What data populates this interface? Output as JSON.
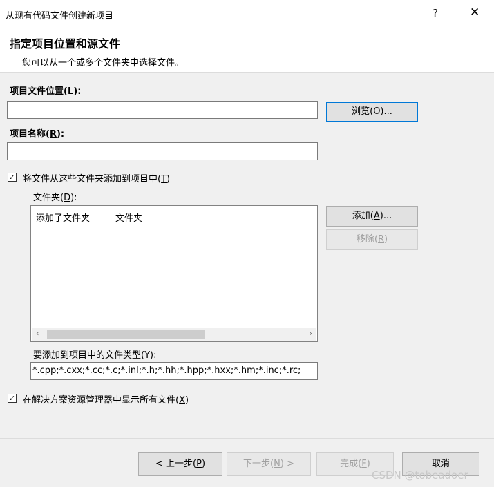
{
  "window": {
    "title": "从现有代码文件创建新项目",
    "help": "?",
    "close": "✕"
  },
  "header": {
    "title": "指定项目位置和源文件",
    "subtitle": "您可以从一个或多个文件夹中选择文件。"
  },
  "location": {
    "label_pre": "项目文件位置(",
    "label_key": "L",
    "label_post": "):",
    "value": "",
    "browse_pre": "浏览(",
    "browse_key": "O",
    "browse_post": ")..."
  },
  "name": {
    "label_pre": "项目名称(",
    "label_key": "R",
    "label_post": "):",
    "value": ""
  },
  "add_folders": {
    "checked": true,
    "label_pre": "将文件从这些文件夹添加到项目中(",
    "label_key": "T",
    "label_post": ")"
  },
  "folders": {
    "label_pre": "文件夹(",
    "label_key": "D",
    "label_post": "):",
    "columns": [
      "添加子文件夹",
      "文件夹"
    ],
    "add_pre": "添加(",
    "add_key": "A",
    "add_post": ")...",
    "remove_pre": "移除(",
    "remove_key": "R",
    "remove_post": ")"
  },
  "filetypes": {
    "label_pre": "要添加到项目中的文件类型(",
    "label_key": "Y",
    "label_post": "):",
    "value": "*.cpp;*.cxx;*.cc;*.c;*.inl;*.h;*.hh;*.hpp;*.hxx;*.hm;*.inc;*.rc;"
  },
  "show_all": {
    "checked": true,
    "label_pre": "在解决方案资源管理器中显示所有文件(",
    "label_key": "X",
    "label_post": ")"
  },
  "buttons": {
    "back_pre": "< 上一步(",
    "back_key": "P",
    "back_post": ")",
    "next_pre": "下一步(",
    "next_key": "N",
    "next_post": ") >",
    "finish_pre": "完成(",
    "finish_key": "F",
    "finish_post": ")",
    "cancel": "取消"
  },
  "watermark": "CSDN @tobeadoer",
  "icons": {
    "check": "✓",
    "left_arrow": "‹",
    "right_arrow": "›"
  }
}
